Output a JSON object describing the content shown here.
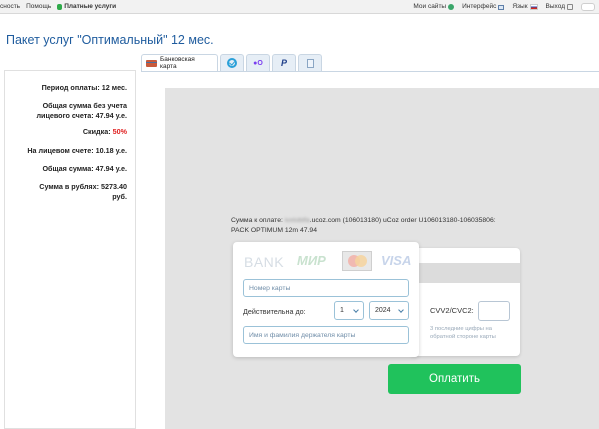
{
  "topbar": {
    "left_items": [
      "сность",
      "Помощь"
    ],
    "paid_services": "Платные услуги",
    "my_sites": "Мои сайты",
    "interface": "Интерфейс",
    "language": "Язык",
    "logout": "Выход"
  },
  "page_title": "Пакет услуг \"Оптимальный\" 12 мес.",
  "tabs": {
    "bank_card": "Банковская карта"
  },
  "summary": {
    "period": "Период оплаты: 12 мес.",
    "total_without_line1": "Общая сумма без учета",
    "total_without_line2": "лицевого счета: 47.94 у.е.",
    "discount_label": "Скидка:",
    "discount_value": "50%",
    "account": "На лицевом счете: 10.18 у.е.",
    "total": "Общая сумма: 47.94 у.е.",
    "rub_line1": "Сумма в рублях: 5273.40",
    "rub_line2": "руб."
  },
  "payment": {
    "amount_prefix": "Сумма к оплате:",
    "amount_blurred": "ivxtobifa",
    "amount_rest": ".ucoz.com (106013180) uCoz order U106013180-106035806: PACK OPTIMUM 12m 47.94",
    "brand_bank": "BANK",
    "brand_mir": "МИР",
    "brand_visa": "VISA",
    "card_number_placeholder": "Номер карты",
    "valid_until": "Действительна до:",
    "month": "1",
    "year": "2024",
    "holder_placeholder": "Имя и фамилия держателя карты",
    "cvv_label": "CVV2/CVC2:",
    "cvv_hint": "3 последние цифры на обратной стороне карты",
    "pay_button": "Оплатить"
  },
  "colors": {
    "title_blue": "#1f5c9e",
    "discount_red": "#e02020",
    "pay_green": "#20c25c"
  }
}
